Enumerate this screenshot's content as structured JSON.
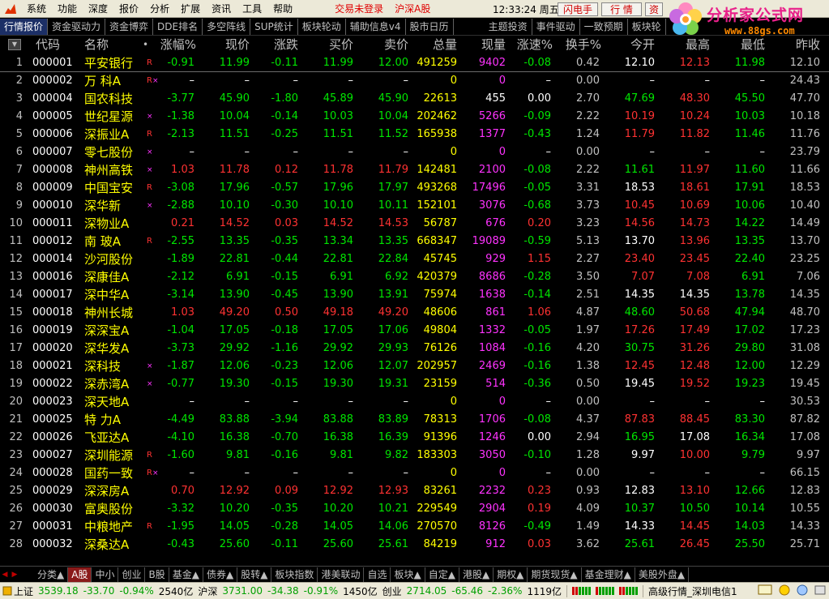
{
  "menu": {
    "items": [
      "系统",
      "功能",
      "深度",
      "报价",
      "分析",
      "扩展",
      "资讯",
      "工具",
      "帮助"
    ],
    "alerts": [
      "交易未登录",
      "沪深A股"
    ],
    "clock": "12:33:24 周五",
    "buttons": [
      "闪电手",
      "行 情",
      "资"
    ]
  },
  "watermark": {
    "title": "分析家公式网",
    "url": "www.88gs.com"
  },
  "tabs": [
    "行情报价",
    "资金驱动力",
    "资金博弈",
    "DDE排名",
    "多空阵线",
    "SUP统计",
    "板块轮动",
    "辅助信息v4",
    "股市日历",
    "主题投资",
    "事件驱动",
    "一致预期",
    "板块轮"
  ],
  "table": {
    "headers": {
      "code": "代码",
      "name": "名称",
      "dot": "•",
      "pct": "涨幅%",
      "price": "现价",
      "chg": "涨跌",
      "bid": "买价",
      "ask": "卖价",
      "vol": "总量",
      "cur": "现量",
      "spd": "涨速%",
      "tnr": "换手%",
      "open": "今开",
      "high": "最高",
      "low": "最低",
      "prev": "昨收"
    },
    "rows": [
      {
        "idx": "1",
        "code": "000001",
        "name": "平安银行",
        "r": "R",
        "x": "",
        "pct": "-0.91",
        "price": "11.99",
        "chg": "-0.11",
        "bid": "11.99",
        "ask": "12.00",
        "vol": "491259",
        "cur": "9402",
        "spd": "-0.08",
        "tnr": "0.42",
        "open": "12.10",
        "high": "12.13",
        "low": "11.98",
        "prev": "12.10",
        "dir": "dn",
        "od": "eq",
        "hd": "up",
        "ld": "dn",
        "sd": "dn"
      },
      {
        "idx": "2",
        "code": "000002",
        "name": "万 科A",
        "r": "R",
        "x": "×",
        "pct": "–",
        "price": "–",
        "chg": "–",
        "bid": "–",
        "ask": "–",
        "vol": "0",
        "cur": "0",
        "spd": "–",
        "tnr": "0.00",
        "open": "–",
        "high": "–",
        "low": "–",
        "prev": "24.43",
        "dir": "eq",
        "od": "eq",
        "hd": "eq",
        "ld": "eq",
        "sd": "eq"
      },
      {
        "idx": "3",
        "code": "000004",
        "name": "国农科技",
        "r": "",
        "x": "",
        "pct": "-3.77",
        "price": "45.90",
        "chg": "-1.80",
        "bid": "45.89",
        "ask": "45.90",
        "vol": "22613",
        "cur": "455",
        "spd": "0.00",
        "tnr": "2.70",
        "open": "47.69",
        "high": "48.30",
        "low": "45.50",
        "prev": "47.70",
        "dir": "dn",
        "od": "dn",
        "hd": "up",
        "ld": "dn",
        "sd": "eq",
        "curc": "eq"
      },
      {
        "idx": "4",
        "code": "000005",
        "name": "世纪星源",
        "r": "",
        "x": "×",
        "pct": "-1.38",
        "price": "10.04",
        "chg": "-0.14",
        "bid": "10.03",
        "ask": "10.04",
        "vol": "202462",
        "cur": "5266",
        "spd": "-0.09",
        "tnr": "2.22",
        "open": "10.19",
        "high": "10.24",
        "low": "10.03",
        "prev": "10.18",
        "dir": "dn",
        "od": "up",
        "hd": "up",
        "ld": "dn",
        "sd": "dn"
      },
      {
        "idx": "5",
        "code": "000006",
        "name": "深振业A",
        "r": "R",
        "x": "",
        "pct": "-2.13",
        "price": "11.51",
        "chg": "-0.25",
        "bid": "11.51",
        "ask": "11.52",
        "vol": "165938",
        "cur": "1377",
        "spd": "-0.43",
        "tnr": "1.24",
        "open": "11.79",
        "high": "11.82",
        "low": "11.46",
        "prev": "11.76",
        "dir": "dn",
        "od": "up",
        "hd": "up",
        "ld": "dn",
        "sd": "dn"
      },
      {
        "idx": "6",
        "code": "000007",
        "name": "零七股份",
        "r": "",
        "x": "×",
        "pct": "–",
        "price": "–",
        "chg": "–",
        "bid": "–",
        "ask": "–",
        "vol": "0",
        "cur": "0",
        "spd": "–",
        "tnr": "0.00",
        "open": "–",
        "high": "–",
        "low": "–",
        "prev": "23.79",
        "dir": "eq",
        "od": "eq",
        "hd": "eq",
        "ld": "eq",
        "sd": "eq"
      },
      {
        "idx": "7",
        "code": "000008",
        "name": "神州高铁",
        "r": "",
        "x": "×",
        "pct": "1.03",
        "price": "11.78",
        "chg": "0.12",
        "bid": "11.78",
        "ask": "11.79",
        "vol": "142481",
        "cur": "2100",
        "spd": "-0.08",
        "tnr": "2.22",
        "open": "11.61",
        "high": "11.97",
        "low": "11.60",
        "prev": "11.66",
        "dir": "up",
        "od": "dn",
        "hd": "up",
        "ld": "dn",
        "sd": "dn"
      },
      {
        "idx": "8",
        "code": "000009",
        "name": "中国宝安",
        "r": "R",
        "x": "",
        "pct": "-3.08",
        "price": "17.96",
        "chg": "-0.57",
        "bid": "17.96",
        "ask": "17.97",
        "vol": "493268",
        "cur": "17496",
        "spd": "-0.05",
        "tnr": "3.31",
        "open": "18.53",
        "high": "18.61",
        "low": "17.91",
        "prev": "18.53",
        "dir": "dn",
        "od": "eq",
        "hd": "up",
        "ld": "dn",
        "sd": "dn"
      },
      {
        "idx": "9",
        "code": "000010",
        "name": "深华新",
        "r": "",
        "x": "×",
        "pct": "-2.88",
        "price": "10.10",
        "chg": "-0.30",
        "bid": "10.10",
        "ask": "10.11",
        "vol": "152101",
        "cur": "3076",
        "spd": "-0.68",
        "tnr": "3.73",
        "open": "10.45",
        "high": "10.69",
        "low": "10.06",
        "prev": "10.40",
        "dir": "dn",
        "od": "up",
        "hd": "up",
        "ld": "dn",
        "sd": "dn"
      },
      {
        "idx": "10",
        "code": "000011",
        "name": "深物业A",
        "r": "",
        "x": "",
        "pct": "0.21",
        "price": "14.52",
        "chg": "0.03",
        "bid": "14.52",
        "ask": "14.53",
        "vol": "56787",
        "cur": "676",
        "spd": "0.20",
        "tnr": "3.23",
        "open": "14.56",
        "high": "14.73",
        "low": "14.22",
        "prev": "14.49",
        "dir": "up",
        "od": "up",
        "hd": "up",
        "ld": "dn",
        "sd": "up"
      },
      {
        "idx": "11",
        "code": "000012",
        "name": "南 玻A",
        "r": "R",
        "x": "",
        "pct": "-2.55",
        "price": "13.35",
        "chg": "-0.35",
        "bid": "13.34",
        "ask": "13.35",
        "vol": "668347",
        "cur": "19089",
        "spd": "-0.59",
        "tnr": "5.13",
        "open": "13.70",
        "high": "13.96",
        "low": "13.35",
        "prev": "13.70",
        "dir": "dn",
        "od": "eq",
        "hd": "up",
        "ld": "dn",
        "sd": "dn"
      },
      {
        "idx": "12",
        "code": "000014",
        "name": "沙河股份",
        "r": "",
        "x": "",
        "pct": "-1.89",
        "price": "22.81",
        "chg": "-0.44",
        "bid": "22.81",
        "ask": "22.84",
        "vol": "45745",
        "cur": "929",
        "spd": "1.15",
        "tnr": "2.27",
        "open": "23.40",
        "high": "23.45",
        "low": "22.40",
        "prev": "23.25",
        "dir": "dn",
        "od": "up",
        "hd": "up",
        "ld": "dn",
        "sd": "up"
      },
      {
        "idx": "13",
        "code": "000016",
        "name": "深康佳A",
        "r": "",
        "x": "",
        "pct": "-2.12",
        "price": "6.91",
        "chg": "-0.15",
        "bid": "6.91",
        "ask": "6.92",
        "vol": "420379",
        "cur": "8686",
        "spd": "-0.28",
        "tnr": "3.50",
        "open": "7.07",
        "high": "7.08",
        "low": "6.91",
        "prev": "7.06",
        "dir": "dn",
        "od": "up",
        "hd": "up",
        "ld": "dn",
        "sd": "dn"
      },
      {
        "idx": "14",
        "code": "000017",
        "name": "深中华A",
        "r": "",
        "x": "",
        "pct": "-3.14",
        "price": "13.90",
        "chg": "-0.45",
        "bid": "13.90",
        "ask": "13.91",
        "vol": "75974",
        "cur": "1638",
        "spd": "-0.14",
        "tnr": "2.51",
        "open": "14.35",
        "high": "14.35",
        "low": "13.78",
        "prev": "14.35",
        "dir": "dn",
        "od": "eq",
        "hd": "eq",
        "ld": "dn",
        "sd": "dn"
      },
      {
        "idx": "15",
        "code": "000018",
        "name": "神州长城",
        "r": "",
        "x": "",
        "pct": "1.03",
        "price": "49.20",
        "chg": "0.50",
        "bid": "49.18",
        "ask": "49.20",
        "vol": "48606",
        "cur": "861",
        "spd": "1.06",
        "tnr": "4.87",
        "open": "48.60",
        "high": "50.68",
        "low": "47.94",
        "prev": "48.70",
        "dir": "up",
        "od": "dn",
        "hd": "up",
        "ld": "dn",
        "sd": "up"
      },
      {
        "idx": "16",
        "code": "000019",
        "name": "深深宝A",
        "r": "",
        "x": "",
        "pct": "-1.04",
        "price": "17.05",
        "chg": "-0.18",
        "bid": "17.05",
        "ask": "17.06",
        "vol": "49804",
        "cur": "1332",
        "spd": "-0.05",
        "tnr": "1.97",
        "open": "17.26",
        "high": "17.49",
        "low": "17.02",
        "prev": "17.23",
        "dir": "dn",
        "od": "up",
        "hd": "up",
        "ld": "dn",
        "sd": "dn"
      },
      {
        "idx": "17",
        "code": "000020",
        "name": "深华发A",
        "r": "",
        "x": "",
        "pct": "-3.73",
        "price": "29.92",
        "chg": "-1.16",
        "bid": "29.92",
        "ask": "29.93",
        "vol": "76126",
        "cur": "1084",
        "spd": "-0.16",
        "tnr": "4.20",
        "open": "30.75",
        "high": "31.26",
        "low": "29.80",
        "prev": "31.08",
        "dir": "dn",
        "od": "dn",
        "hd": "up",
        "ld": "dn",
        "sd": "dn"
      },
      {
        "idx": "18",
        "code": "000021",
        "name": "深科技",
        "r": "",
        "x": "×",
        "pct": "-1.87",
        "price": "12.06",
        "chg": "-0.23",
        "bid": "12.06",
        "ask": "12.07",
        "vol": "202957",
        "cur": "2469",
        "spd": "-0.16",
        "tnr": "1.38",
        "open": "12.45",
        "high": "12.48",
        "low": "12.00",
        "prev": "12.29",
        "dir": "dn",
        "od": "up",
        "hd": "up",
        "ld": "dn",
        "sd": "dn"
      },
      {
        "idx": "19",
        "code": "000022",
        "name": "深赤湾A",
        "r": "",
        "x": "×",
        "pct": "-0.77",
        "price": "19.30",
        "chg": "-0.15",
        "bid": "19.30",
        "ask": "19.31",
        "vol": "23159",
        "cur": "514",
        "spd": "-0.36",
        "tnr": "0.50",
        "open": "19.45",
        "high": "19.52",
        "low": "19.23",
        "prev": "19.45",
        "dir": "dn",
        "od": "eq",
        "hd": "up",
        "ld": "dn",
        "sd": "dn"
      },
      {
        "idx": "20",
        "code": "000023",
        "name": "深天地A",
        "r": "",
        "x": "",
        "pct": "–",
        "price": "–",
        "chg": "–",
        "bid": "–",
        "ask": "–",
        "vol": "0",
        "cur": "0",
        "spd": "–",
        "tnr": "0.00",
        "open": "–",
        "high": "–",
        "low": "–",
        "prev": "30.53",
        "dir": "eq",
        "od": "eq",
        "hd": "eq",
        "ld": "eq",
        "sd": "eq"
      },
      {
        "idx": "21",
        "code": "000025",
        "name": "特 力A",
        "r": "",
        "x": "",
        "pct": "-4.49",
        "price": "83.88",
        "chg": "-3.94",
        "bid": "83.88",
        "ask": "83.89",
        "vol": "78313",
        "cur": "1706",
        "spd": "-0.08",
        "tnr": "4.37",
        "open": "87.83",
        "high": "88.45",
        "low": "83.30",
        "prev": "87.82",
        "dir": "dn",
        "od": "up",
        "hd": "up",
        "ld": "dn",
        "sd": "dn"
      },
      {
        "idx": "22",
        "code": "000026",
        "name": "飞亚达A",
        "r": "",
        "x": "",
        "pct": "-4.10",
        "price": "16.38",
        "chg": "-0.70",
        "bid": "16.38",
        "ask": "16.39",
        "vol": "91396",
        "cur": "1246",
        "spd": "0.00",
        "tnr": "2.94",
        "open": "16.95",
        "high": "17.08",
        "low": "16.34",
        "prev": "17.08",
        "dir": "dn",
        "od": "dn",
        "hd": "eq",
        "ld": "dn",
        "sd": "eq"
      },
      {
        "idx": "23",
        "code": "000027",
        "name": "深圳能源",
        "r": "R",
        "x": "",
        "pct": "-1.60",
        "price": "9.81",
        "chg": "-0.16",
        "bid": "9.81",
        "ask": "9.82",
        "vol": "183303",
        "cur": "3050",
        "spd": "-0.10",
        "tnr": "1.28",
        "open": "9.97",
        "high": "10.00",
        "low": "9.79",
        "prev": "9.97",
        "dir": "dn",
        "od": "eq",
        "hd": "up",
        "ld": "dn",
        "sd": "dn"
      },
      {
        "idx": "24",
        "code": "000028",
        "name": "国药一致",
        "r": "R",
        "x": "×",
        "pct": "–",
        "price": "–",
        "chg": "–",
        "bid": "–",
        "ask": "–",
        "vol": "0",
        "cur": "0",
        "spd": "–",
        "tnr": "0.00",
        "open": "–",
        "high": "–",
        "low": "–",
        "prev": "66.15",
        "dir": "eq",
        "od": "eq",
        "hd": "eq",
        "ld": "eq",
        "sd": "eq"
      },
      {
        "idx": "25",
        "code": "000029",
        "name": "深深房A",
        "r": "",
        "x": "",
        "pct": "0.70",
        "price": "12.92",
        "chg": "0.09",
        "bid": "12.92",
        "ask": "12.93",
        "vol": "83261",
        "cur": "2232",
        "spd": "0.23",
        "tnr": "0.93",
        "open": "12.83",
        "high": "13.10",
        "low": "12.66",
        "prev": "12.83",
        "dir": "up",
        "od": "eq",
        "hd": "up",
        "ld": "dn",
        "sd": "up"
      },
      {
        "idx": "26",
        "code": "000030",
        "name": "富奥股份",
        "r": "",
        "x": "",
        "pct": "-3.32",
        "price": "10.20",
        "chg": "-0.35",
        "bid": "10.20",
        "ask": "10.21",
        "vol": "229549",
        "cur": "2904",
        "spd": "0.19",
        "tnr": "4.09",
        "open": "10.37",
        "high": "10.50",
        "low": "10.14",
        "prev": "10.55",
        "dir": "dn",
        "od": "dn",
        "hd": "dn",
        "ld": "dn",
        "sd": "up"
      },
      {
        "idx": "27",
        "code": "000031",
        "name": "中粮地产",
        "r": "R",
        "x": "",
        "pct": "-1.95",
        "price": "14.05",
        "chg": "-0.28",
        "bid": "14.05",
        "ask": "14.06",
        "vol": "270570",
        "cur": "8126",
        "spd": "-0.49",
        "tnr": "1.49",
        "open": "14.33",
        "high": "14.45",
        "low": "14.03",
        "prev": "14.33",
        "dir": "dn",
        "od": "eq",
        "hd": "up",
        "ld": "dn",
        "sd": "dn"
      },
      {
        "idx": "28",
        "code": "000032",
        "name": "深桑达A",
        "r": "",
        "x": "",
        "pct": "-0.43",
        "price": "25.60",
        "chg": "-0.11",
        "bid": "25.60",
        "ask": "25.61",
        "vol": "84219",
        "cur": "912",
        "spd": "0.03",
        "tnr": "3.62",
        "open": "25.61",
        "high": "26.45",
        "low": "25.50",
        "prev": "25.71",
        "dir": "dn",
        "od": "dn",
        "hd": "up",
        "ld": "dn",
        "sd": "up"
      }
    ]
  },
  "categories": [
    "分类▲",
    "A股",
    "中小",
    "创业",
    "B股",
    "基金▲",
    "债券▲",
    "股转▲",
    "板块指数",
    "港美联动",
    "自选",
    "板块▲",
    "自定▲",
    "港股▲",
    "期权▲",
    "期货现货▲",
    "基金理财▲",
    "美股外盘▲"
  ],
  "status": {
    "sh_label": "上证",
    "sh_value": "3539.18",
    "sh_chg": "-33.70",
    "sh_pct": "-0.94%",
    "sh_amt": "2540亿",
    "sz_label": "沪深",
    "sz_value": "3731.00",
    "sz_chg": "-34.38",
    "sz_pct": "-0.91%",
    "sz_amt": "1450亿",
    "cy_label": "创业",
    "cy_value": "2714.05",
    "cy_chg": "-65.46",
    "cy_pct": "-2.36%",
    "cy_amt": "1119亿",
    "server": "高级行情_深圳电信1"
  }
}
